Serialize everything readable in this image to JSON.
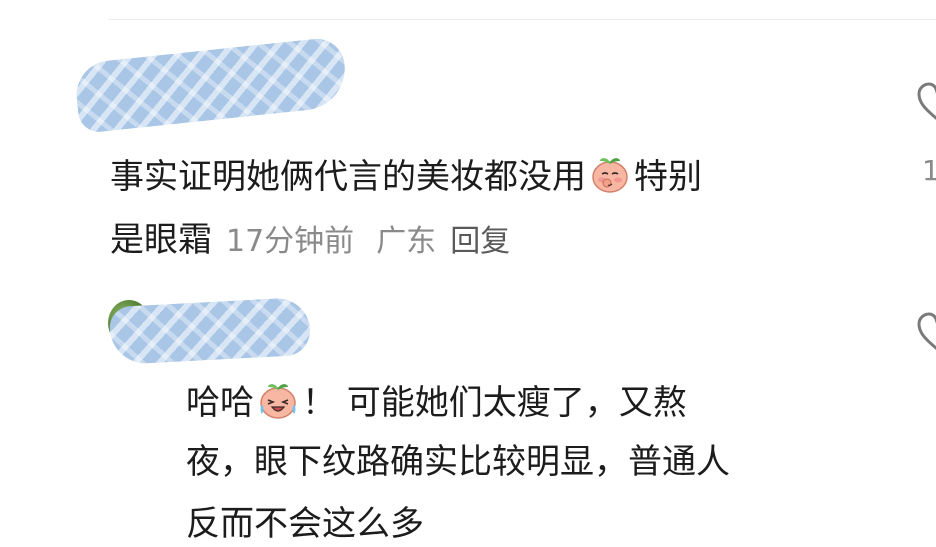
{
  "comments": [
    {
      "author": "",
      "text_part1": "事实证明她俩代言的美妆都没用",
      "emoji": "peach-shy",
      "text_part2": "特别",
      "text_line2": "是眼霜",
      "time": "17分钟前",
      "region": "广东",
      "reply_label": "回复",
      "likes": "1"
    },
    {
      "author": "",
      "text_part1": "哈哈",
      "emoji": "peach-crying-laugh",
      "text_part2": "！ 可能她们太瘦了，又熬",
      "text_line2": "夜，眼下纹路确实比较明显，普通人",
      "text_line3": "反而不会这么多"
    }
  ],
  "colors": {
    "text": "#1c1c1c",
    "meta": "#8a8a8a",
    "redaction": "#a9c6e6"
  }
}
